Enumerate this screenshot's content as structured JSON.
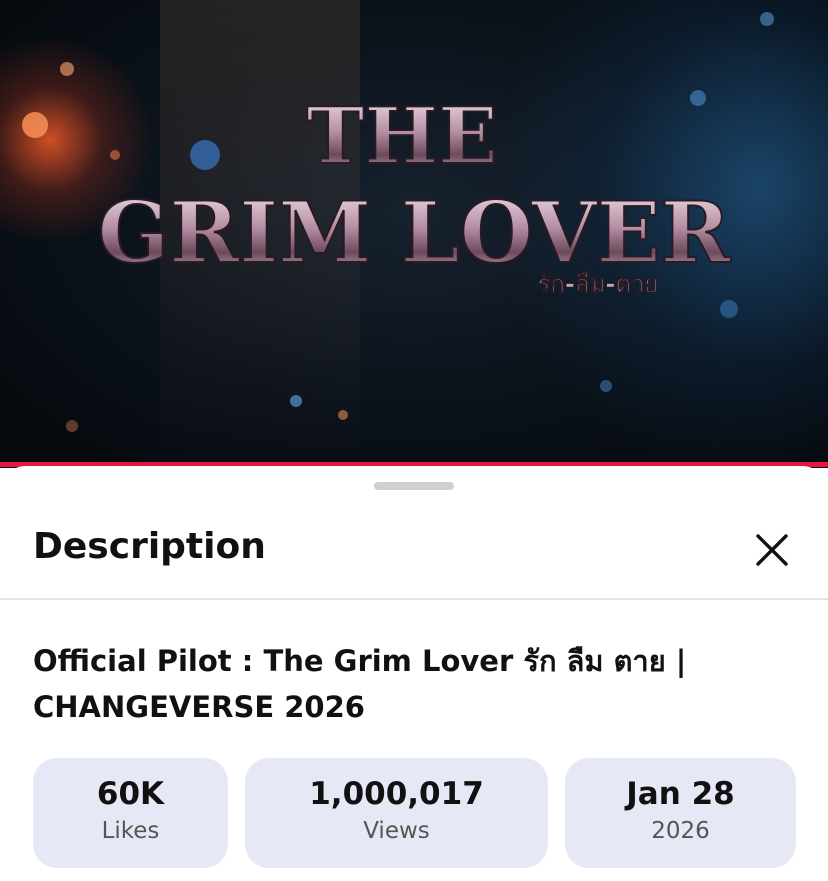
{
  "video": {
    "logo_line1": "THE",
    "logo_line2": "GRIM LOVER",
    "logo_thai": "รัก-ลืม-ตาย",
    "progress_fraction": 1.0,
    "progress_color": "#e8163f"
  },
  "sheet": {
    "title": "Description",
    "close_icon": "close-icon",
    "video_title_line1": "Official Pilot : The Grim Lover รัก ลืม ตาย |",
    "video_title_line2": "CHANGEVERSE 2026",
    "stats": [
      {
        "value": "60K",
        "label": "Likes"
      },
      {
        "value": "1,000,017",
        "label": "Views"
      },
      {
        "value": "Jan 28",
        "label": "2026"
      }
    ],
    "card_color": "#e6e9f5"
  }
}
